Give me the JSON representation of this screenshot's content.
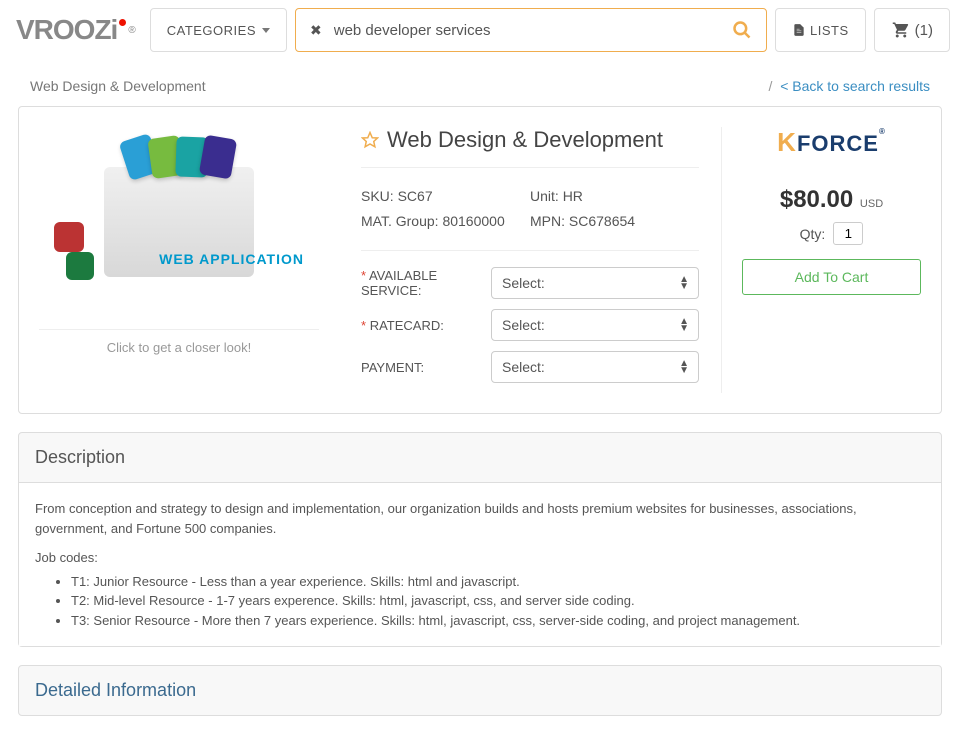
{
  "header": {
    "logo": "VROOZi",
    "categories_label": "CATEGORIES",
    "search_value": "web developer services",
    "lists_label": "LISTS",
    "cart_count": "(1)"
  },
  "breadcrumb": {
    "left": "Web Design & Development",
    "back_link": "< Back to search results",
    "separator": "/"
  },
  "product": {
    "title": "Web Design & Development",
    "image_caption": "Click to get a closer look!",
    "image_overlay": "WEB APPLICATION",
    "sku_label": "SKU:",
    "sku_value": "SC67",
    "matgroup_label": "MAT. Group:",
    "matgroup_value": "80160000",
    "unit_label": "Unit:",
    "unit_value": "HR",
    "mpn_label": "MPN:",
    "mpn_value": "SC678654"
  },
  "options": {
    "available_label": "AVAILABLE SERVICE:",
    "ratecard_label": "RATECARD:",
    "payment_label": "PAYMENT:",
    "select_placeholder": "Select:"
  },
  "buy": {
    "vendor": "KFORCE",
    "price": "$80.00",
    "currency": "USD",
    "qty_label": "Qty:",
    "qty_value": "1",
    "add_to_cart": "Add To Cart"
  },
  "description": {
    "heading": "Description",
    "intro": "From conception and strategy to design and implementation, our organization builds and hosts premium websites for businesses, associations, government, and Fortune 500 companies.",
    "jobcodes_label": "Job codes:",
    "codes": [
      "T1: Junior Resource - Less than a year experience. Skills: html and javascript.",
      "T2: Mid-level Resource - 1-7 years experence. Skills: html, javascript, css, and server side coding.",
      "T3: Senior Resource - More then 7 years experience. Skills: html, javascript, css, server-side coding, and project management."
    ]
  },
  "detailed": {
    "heading": "Detailed Information"
  }
}
